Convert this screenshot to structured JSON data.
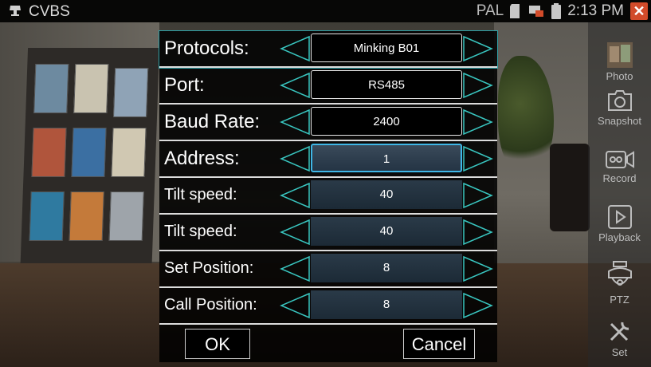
{
  "status_bar": {
    "title": "CVBS",
    "video_standard": "PAL",
    "time": "2:13 PM"
  },
  "dialog": {
    "rows": [
      {
        "label": "Protocols:",
        "value": "Minking B01"
      },
      {
        "label": "Port:",
        "value": "RS485"
      },
      {
        "label": "Baud Rate:",
        "value": "2400"
      },
      {
        "label": "Address:",
        "value": "1"
      },
      {
        "label": "Tilt speed:",
        "value": "40"
      },
      {
        "label": "Tilt speed:",
        "value": "40"
      },
      {
        "label": "Set Position:",
        "value": "8"
      },
      {
        "label": "Call Position:",
        "value": "8"
      }
    ],
    "ok_label": "OK",
    "cancel_label": "Cancel"
  },
  "toolbar": {
    "photo": "Photo",
    "snapshot": "Snapshot",
    "record": "Record",
    "playback": "Playback",
    "ptz": "PTZ",
    "set": "Set"
  },
  "colors": {
    "accent": "#3fb6e6",
    "arrow_stroke": "#39c6c0",
    "close_button": "#d24b2a"
  }
}
